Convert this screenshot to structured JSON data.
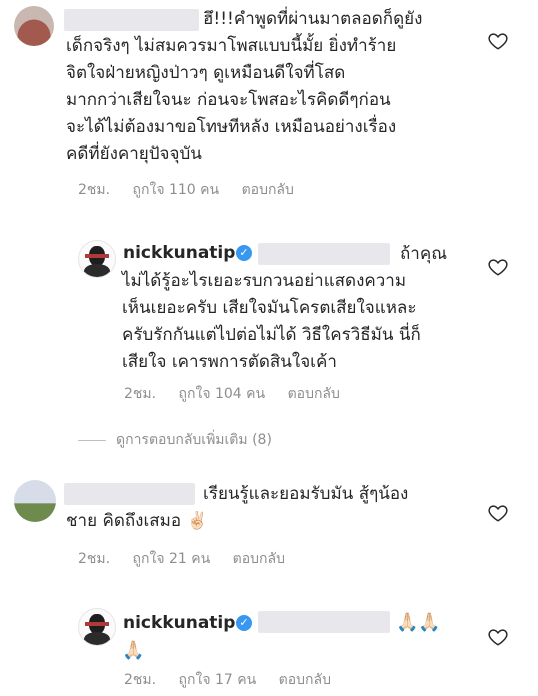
{
  "comments": [
    {
      "text": "ฮึ!!!คำพูดที่ผ่านมาตลอดก็ดูยัง\nเด็กจริงๆ ไม่สมควรมาโพสแบบนี้มั้ย ยิ่งทำร้าย\nจิตใจฝ่ายหญิงป่าวๆ ดูเหมือนดีใจที่โสด\nมากกว่าเสียใจนะ ก่อนจะโพสอะไรคิดดีๆก่อน\nจะได้ไม่ต้องมาขอโทษทีหลัง เหมือนอย่างเรื่อง\nคดีที่ยังคายุปัจจุบัน",
      "time": "2ชม.",
      "likes": "ถูกใจ 110 คน",
      "reply": "ตอบกลับ"
    },
    {
      "username": "nickkunatip",
      "text": "ถ้าคุณ\nไม่ได้รู้อะไรเยอะรบกวนอย่าแสดงความ\nเห็นเยอะครับ เสียใจมันโครตเสียใจแหละ\nครับรักกันแต่ไปต่อไม่ได้ วิธีใครวิธีมัน นี่ก็\nเสียใจ เคารพการตัดสินใจเค้า",
      "time": "2ชม.",
      "likes": "ถูกใจ 104 คน",
      "reply": "ตอบกลับ"
    },
    {
      "text": "เรียนรู้และยอมรับมัน สู้ๆน้อง\nชาย คิดถึงเสมอ ✌🏻",
      "time": "2ชม.",
      "likes": "ถูกใจ 21 คน",
      "reply": "ตอบกลับ"
    },
    {
      "username": "nickkunatip",
      "text": "🙏🏻🙏🏻\n🙏🏻",
      "time": "2ชม.",
      "likes": "ถูกใจ 17 คน",
      "reply": "ตอบกลับ"
    }
  ],
  "view_more_replies": "ดูการตอบกลับเพิ่มเติม (8)",
  "icons": {
    "like": "heart-outline-icon",
    "verified": "verified-badge-icon"
  },
  "colors": {
    "verified": "#3897f0",
    "meta": "#8e8e8e",
    "text": "#262626"
  }
}
